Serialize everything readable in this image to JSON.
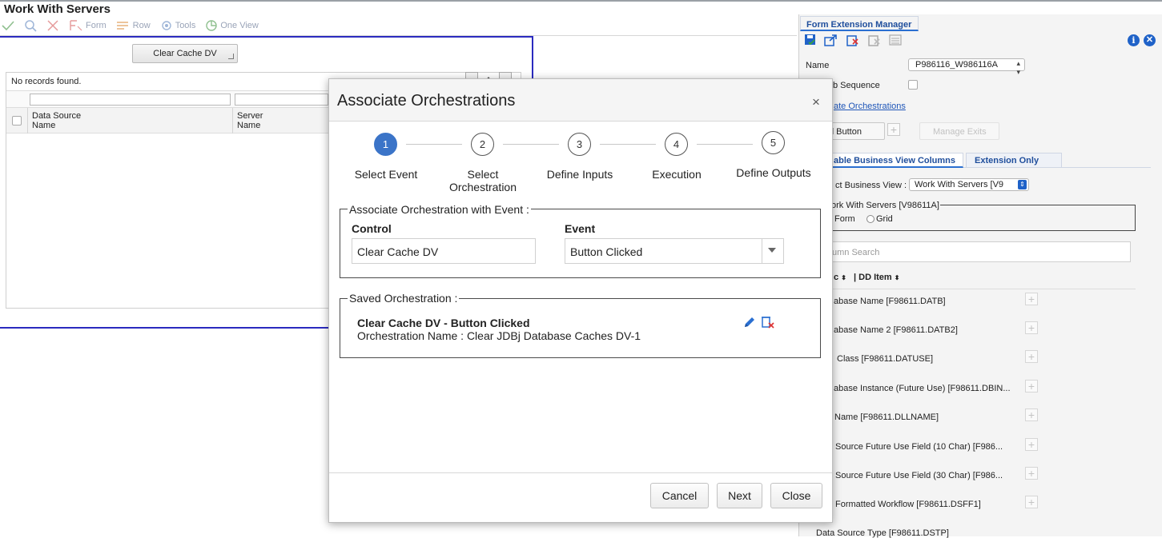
{
  "app": {
    "title": "Work With Servers",
    "toolbar": {
      "form_label": "Form",
      "row_label": "Row",
      "tools_label": "Tools",
      "oneview_label": "One View"
    },
    "form_button": "Clear Cache DV",
    "grid": {
      "empty_message": "No records found.",
      "columns": [
        "Data Source\nName",
        "Server\nName"
      ]
    }
  },
  "fem": {
    "tab_title": "Form Extension Manager",
    "name_label": "Name",
    "name_value": "P986116_W986116A",
    "tab_sequence_label": "b Sequence",
    "assoc_link": "ate Orchestrations",
    "add_button_label": "d Button",
    "manage_exits_label": "Manage Exits",
    "tabs": [
      "able Business View Columns",
      "Extension Only"
    ],
    "select_bv_label": "ct Business View :",
    "select_bv_value": "Work With Servers [V9",
    "fieldset_legend": "ork With Servers [V98611A]",
    "radio_form": "Form",
    "radio_grid": "Grid",
    "search_placeholder": "umn Search",
    "col_desc": "c",
    "col_dd": "| DD Item",
    "dd_items": [
      "abase Name [F98611.DATB]",
      "abase Name 2 [F98611.DATB2]",
      "Class [F98611.DATUSE]",
      "abase Instance (Future Use) [F98611.DBIN...",
      "Name [F98611.DLLNAME]",
      "Source Future Use Field (10 Char) [F986...",
      "Source Future Use Field (30 Char) [F986...",
      "Formatted Workflow [F98611.DSFF1]",
      "Data Source Type [F98611.DSTP]"
    ],
    "colors": {
      "accent": "#1f62c8",
      "link": "#1f56b8"
    }
  },
  "modal": {
    "title": "Associate Orchestrations",
    "close_glyph": "×",
    "steps": [
      {
        "num": "1",
        "label": "Select Event"
      },
      {
        "num": "2",
        "label": "Select\nOrchestration"
      },
      {
        "num": "3",
        "label": "Define Inputs"
      },
      {
        "num": "4",
        "label": "Execution"
      },
      {
        "num": "5",
        "label": "Define Outputs"
      }
    ],
    "assoc_legend": "Associate Orchestration with Event :",
    "control_label": "Control",
    "control_value": "Clear Cache DV",
    "event_label": "Event",
    "event_value": "Button Clicked",
    "saved_legend": "Saved Orchestration :",
    "saved_title": "Clear Cache DV - Button Clicked",
    "saved_sub": "Orchestration Name : Clear JDBj Database Caches DV-1",
    "buttons": {
      "cancel": "Cancel",
      "next": "Next",
      "close": "Close"
    },
    "colors": {
      "active_step": "#3b74c8"
    }
  }
}
